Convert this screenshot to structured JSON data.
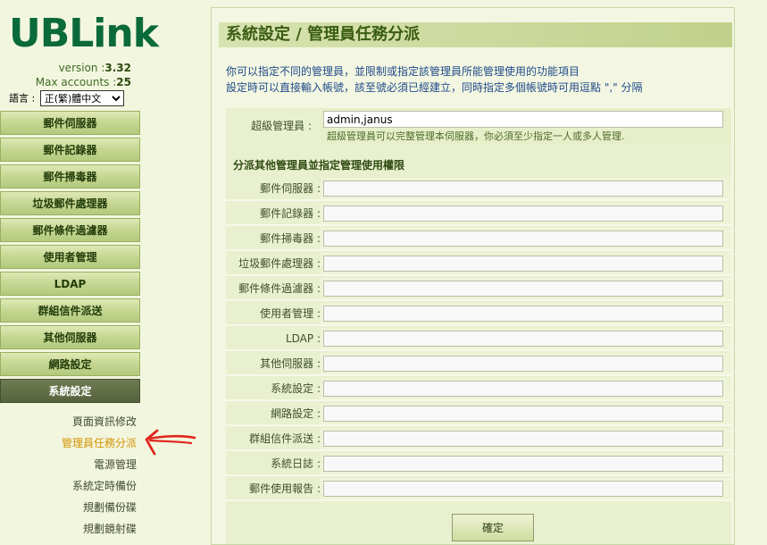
{
  "sidebar": {
    "logo": "UBLink",
    "version_label": "version :",
    "version_value": "3.32",
    "accounts_label": "Max accounts :",
    "accounts_value": "25",
    "language_label": "語言 :",
    "language_selected": "正(繁)體中文",
    "nav": [
      {
        "label": "郵件伺服器"
      },
      {
        "label": "郵件記錄器"
      },
      {
        "label": "郵件掃毒器"
      },
      {
        "label": "垃圾郵件處理器"
      },
      {
        "label": "郵件條件過濾器"
      },
      {
        "label": "使用者管理"
      },
      {
        "label": "LDAP"
      },
      {
        "label": "群組信件派送"
      },
      {
        "label": "其他伺服器"
      },
      {
        "label": "網路設定"
      },
      {
        "label": "系統設定"
      }
    ],
    "subnav": [
      {
        "label": "頁面資訊修改"
      },
      {
        "label": "管理員任務分派"
      },
      {
        "label": "電源管理"
      },
      {
        "label": "系統定時備份"
      },
      {
        "label": "規劃備份碟"
      },
      {
        "label": "規劃鏡射碟"
      }
    ]
  },
  "main": {
    "title": "系統設定 / 管理員任務分派",
    "desc1": "你可以指定不同的管理員，並限制或指定該管理員所能管理使用的功能項目",
    "desc2": "設定時可以直接輸入帳號，該至號必須已經建立，同時指定多個帳號時可用逗點 \",\" 分隔",
    "super_label": "超級管理員 :",
    "super_value": "admin,janus",
    "super_note": "超級管理員可以完整管理本伺服器，你必須至少指定一人或多人管理.",
    "section_heading": "分派其他管理員並指定管理使用權限",
    "fields": [
      {
        "label": "郵件伺服器 :",
        "value": ""
      },
      {
        "label": "郵件記錄器 :",
        "value": ""
      },
      {
        "label": "郵件掃毒器 :",
        "value": ""
      },
      {
        "label": "垃圾郵件處理器 :",
        "value": ""
      },
      {
        "label": "郵件條件過濾器 :",
        "value": ""
      },
      {
        "label": "使用者管理 :",
        "value": ""
      },
      {
        "label": "LDAP :",
        "value": ""
      },
      {
        "label": "其他伺服器 :",
        "value": ""
      },
      {
        "label": "系統設定 :",
        "value": ""
      },
      {
        "label": "網路設定 :",
        "value": ""
      },
      {
        "label": "群組信件派送 :",
        "value": ""
      },
      {
        "label": "系統日誌 :",
        "value": ""
      },
      {
        "label": "郵件使用報告 :",
        "value": ""
      }
    ],
    "ok_label": "確定"
  },
  "colors": {
    "accent": "#3a5c12",
    "active_subnav": "#d39200",
    "annotation_arrow": "#e0241c"
  }
}
